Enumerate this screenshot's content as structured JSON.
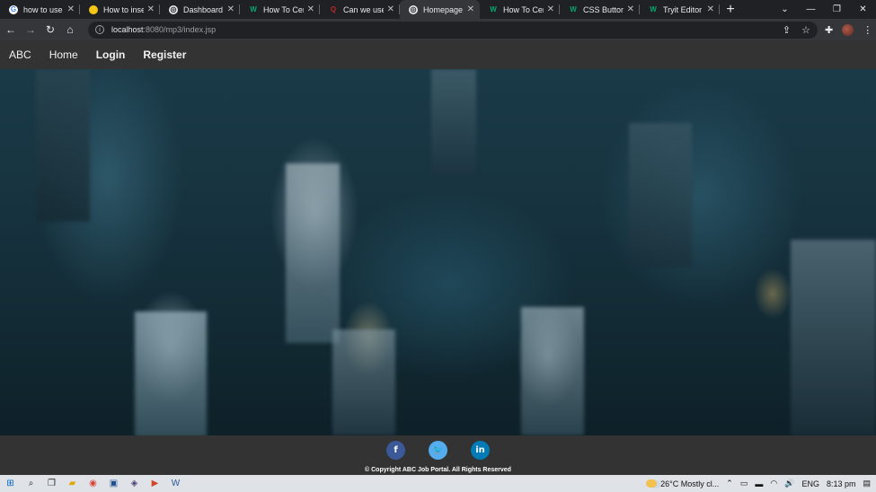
{
  "browser": {
    "tabs": [
      {
        "title": "how to use im",
        "favicon": "G",
        "favicon_color": "#ffffff",
        "favicon_text": "#4285f4",
        "active": false
      },
      {
        "title": "How to insert",
        "favicon": "",
        "favicon_color": "#f5c518",
        "favicon_text": "#000000",
        "active": false
      },
      {
        "title": "Dashboard",
        "favicon": "◎",
        "favicon_color": "#e8eaed",
        "favicon_text": "#202124",
        "active": false
      },
      {
        "title": "How To Cente",
        "favicon": "W",
        "favicon_color": "transparent",
        "favicon_text": "#04aa6d",
        "active": false
      },
      {
        "title": "Can we use C",
        "favicon": "Q",
        "favicon_color": "transparent",
        "favicon_text": "#b92b27",
        "active": false
      },
      {
        "title": "Homepage",
        "favicon": "◎",
        "favicon_color": "#e8eaed",
        "favicon_text": "#202124",
        "active": true
      },
      {
        "title": "How To Cente",
        "favicon": "W",
        "favicon_color": "transparent",
        "favicon_text": "#04aa6d",
        "active": false
      },
      {
        "title": "CSS Buttons",
        "favicon": "W",
        "favicon_color": "transparent",
        "favicon_text": "#04aa6d",
        "active": false
      },
      {
        "title": "Tryit Editor v3",
        "favicon": "W",
        "favicon_color": "transparent",
        "favicon_text": "#04aa6d",
        "active": false
      }
    ],
    "close_glyph": "✕",
    "new_tab_glyph": "+",
    "url_host": "localhost",
    "url_path": ":8080/mp3/index.jsp"
  },
  "site": {
    "nav": {
      "brand": "ABC",
      "home": "Home",
      "login": "Login",
      "register": "Register"
    },
    "footer": {
      "facebook": "f",
      "twitter": "🐦",
      "linkedin": "in",
      "copyright": "© Copyright ABC Job Portal. All Rights Reserved"
    }
  },
  "taskbar": {
    "weather": "26°C  Mostly cl...",
    "language": "ENG",
    "time": "8:13 pm"
  }
}
